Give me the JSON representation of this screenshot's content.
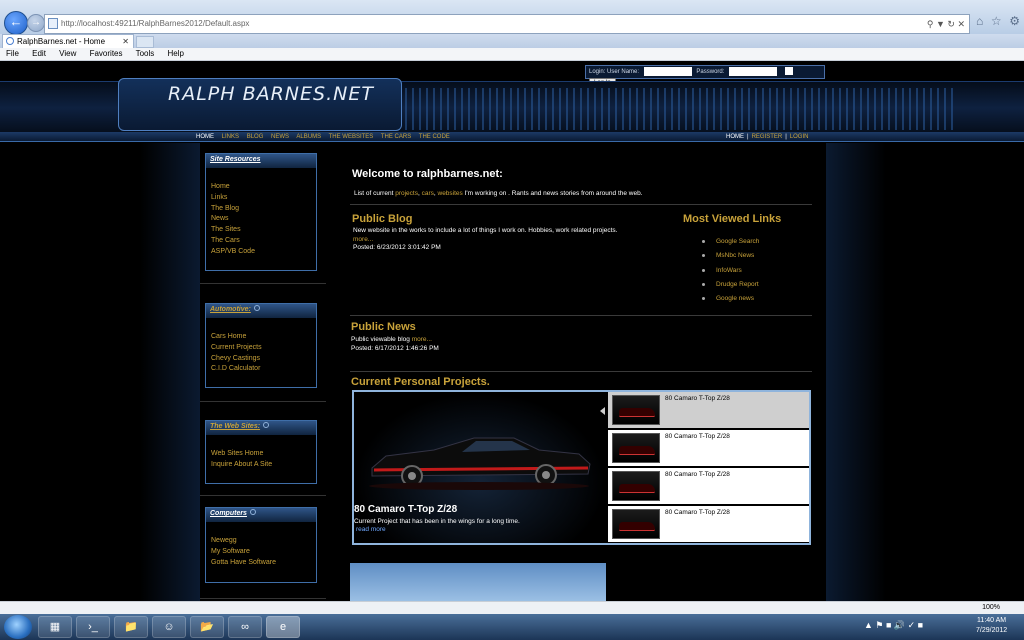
{
  "browser": {
    "url": "http://localhost:49211/RalphBarnes2012/Default.aspx",
    "tab_title": "RalphBarnes.net - Home",
    "menu": [
      "File",
      "Edit",
      "View",
      "Favorites",
      "Tools",
      "Help"
    ],
    "zoom": "100%"
  },
  "login": {
    "label": "Login:",
    "username_label": "User Name:",
    "password_label": "Password:",
    "button": "Log In"
  },
  "site": {
    "logo": "RALPH BARNES.NET",
    "nav": [
      "HOME",
      "LINKS",
      "BLOG",
      "NEWS",
      "ALBUMS",
      "THE WEBSITES",
      "THE CARS",
      "THE CODE"
    ],
    "nav_right": [
      "HOME",
      "REGISTER",
      "LOGIN"
    ]
  },
  "sidebar": {
    "site_resources": {
      "title": "Site Resources",
      "items": [
        "Home",
        "Links",
        "The Blog",
        "News",
        "The Sites",
        "The Cars",
        "ASP/VB Code"
      ]
    },
    "automotive": {
      "title": "Automotive:",
      "items": [
        "Cars Home",
        "Current Projects",
        "Chevy Castings",
        "C.I.D Calculator"
      ]
    },
    "web_sites": {
      "title": "The Web Sites:",
      "items": [
        "Web Sites Home",
        "Inquire About A Site"
      ]
    },
    "computers": {
      "title": "Computers",
      "items": [
        "Newegg",
        "My Software",
        "Gotta Have Software"
      ]
    }
  },
  "main": {
    "welcome_title": "Welcome to ralphbarnes.net:",
    "welcome_pre": "List of current",
    "welcome_links": [
      "projects",
      "cars",
      "websites"
    ],
    "welcome_post": "I'm working on . Rants and news stories from around the web.",
    "blog": {
      "title": "Public Blog",
      "text": "New website in the works to include a lot of things I work on. Hobbies, work related projects.",
      "more": "more...",
      "posted": "Posted: 6/23/2012 3:01:42 PM"
    },
    "most_viewed": {
      "title": "Most Viewed Links",
      "items": [
        "Google Search",
        "MsNbc News",
        "InfoWars",
        "Drudge Report",
        "Google news"
      ]
    },
    "news": {
      "title": "Public News",
      "text": "Public viewable blog",
      "more": "more...",
      "posted": "Posted: 6/17/2012 1:46:26 PM"
    },
    "projects": {
      "title": "Current Personal Projects.",
      "slide_title": "80 Camaro T-Top Z/28",
      "slide_text": "Current Project that has been in the wings for a long time.",
      "slide_more": "read more",
      "thumbs": [
        "80 Camaro T-Top Z/28",
        "80 Camaro T-Top Z/28",
        "80 Camaro T-Top Z/28",
        "80 Camaro T-Top Z/28"
      ]
    }
  },
  "taskbar": {
    "time": "11:40 AM",
    "date": "7/29/2012"
  }
}
